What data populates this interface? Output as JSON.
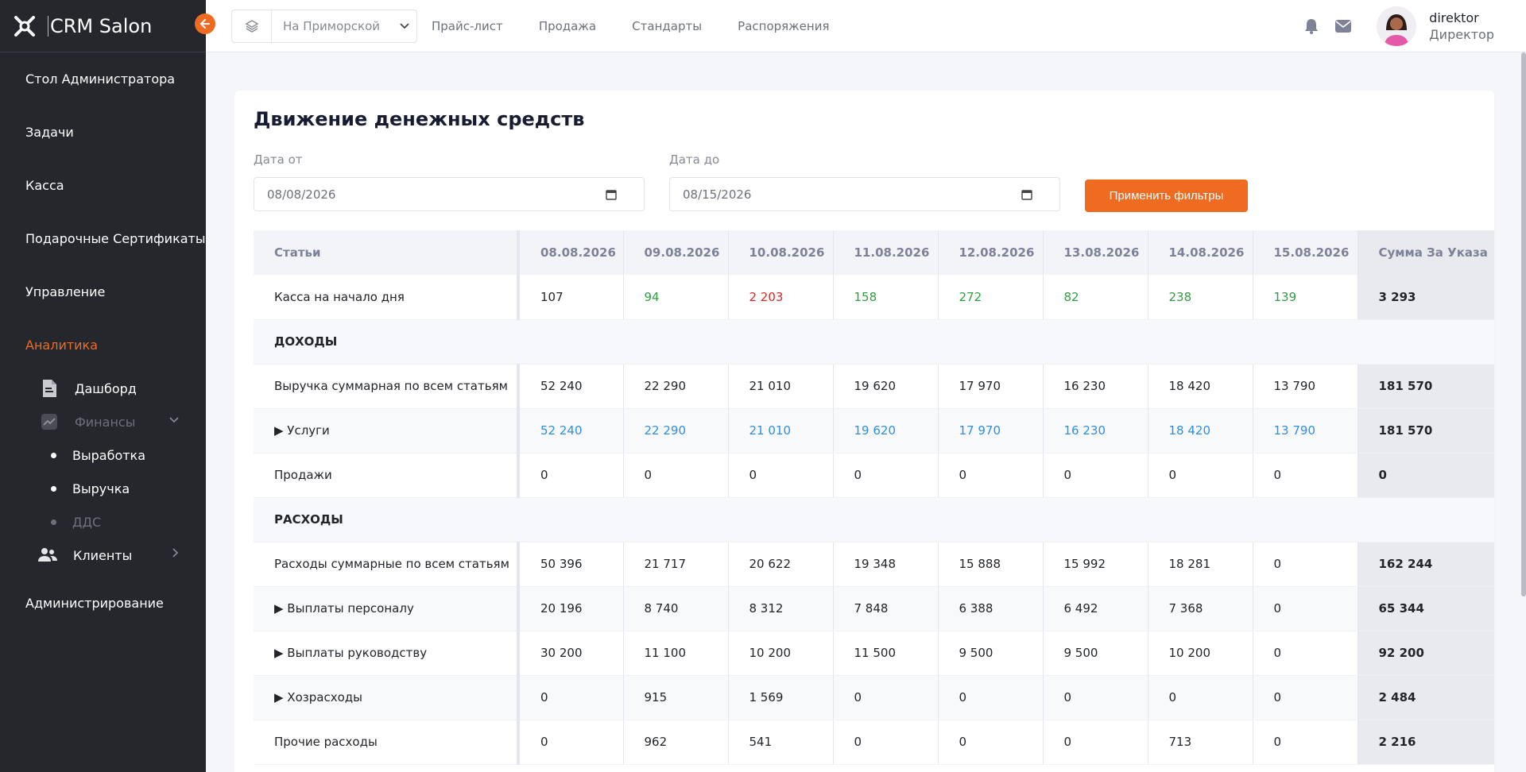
{
  "sidebar": {
    "brand": "CRM Salon",
    "items": [
      {
        "label": "Стол Администратора"
      },
      {
        "label": "Задачи"
      },
      {
        "label": "Касса"
      },
      {
        "label": "Подарочные Сертификаты"
      },
      {
        "label": "Управление"
      },
      {
        "label": "Аналитика"
      }
    ],
    "analytics_sub": {
      "dashboard": "Дашборд",
      "finance": "Финансы",
      "finance_items": [
        "Выработка",
        "Выручка",
        "ДДС"
      ],
      "clients": "Клиенты"
    },
    "admin": "Администрирование"
  },
  "topbar": {
    "branch": "На Приморской",
    "nav": [
      "Прайс-лист",
      "Продажа",
      "Стандарты",
      "Распоряжения"
    ],
    "user_name": "direktor",
    "user_role": "Директор"
  },
  "card": {
    "title": "Движение денежных средств",
    "date_from_label": "Дата от",
    "date_from": "08/08/2026",
    "date_to_label": "Дата до",
    "date_to": "08/15/2026",
    "apply": "Применить фильтры"
  },
  "table": {
    "headers": [
      "Статьи",
      "08.08.2026",
      "09.08.2026",
      "10.08.2026",
      "11.08.2026",
      "12.08.2026",
      "13.08.2026",
      "14.08.2026",
      "15.08.2026",
      "Сумма За Указа"
    ],
    "rows": [
      {
        "label": "Касса на начало дня",
        "cells": [
          "107",
          "94",
          "2 203",
          "158",
          "272",
          "82",
          "238",
          "139"
        ],
        "colors": [
          "",
          "green",
          "red",
          "green",
          "green",
          "green",
          "green",
          "green"
        ],
        "sum": "3 293"
      },
      {
        "section": "ДОХОДЫ"
      },
      {
        "label": "Выручка суммарная по всем статьям",
        "cells": [
          "52 240",
          "22 290",
          "21 010",
          "19 620",
          "17 970",
          "16 230",
          "18 420",
          "13 790"
        ],
        "sum": "181 570"
      },
      {
        "label": "▶ Услуги",
        "cells": [
          "52 240",
          "22 290",
          "21 010",
          "19 620",
          "17 970",
          "16 230",
          "18 420",
          "13 790"
        ],
        "color": "blue",
        "sum": "181 570",
        "alt": true
      },
      {
        "label": "Продажи",
        "cells": [
          "0",
          "0",
          "0",
          "0",
          "0",
          "0",
          "0",
          "0"
        ],
        "sum": "0"
      },
      {
        "section": "РАСХОДЫ"
      },
      {
        "label": "Расходы суммарные по всем статьям",
        "cells": [
          "50 396",
          "21 717",
          "20 622",
          "19 348",
          "15 888",
          "15 992",
          "18 281",
          "0"
        ],
        "sum": "162 244"
      },
      {
        "label": "▶ Выплаты персоналу",
        "cells": [
          "20 196",
          "8 740",
          "8 312",
          "7 848",
          "6 388",
          "6 492",
          "7 368",
          "0"
        ],
        "sum": "65 344",
        "alt": true
      },
      {
        "label": "▶ Выплаты руководству",
        "cells": [
          "30 200",
          "11 100",
          "10 200",
          "11 500",
          "9 500",
          "9 500",
          "10 200",
          "0"
        ],
        "sum": "92 200"
      },
      {
        "label": "▶ Хозрасходы",
        "cells": [
          "0",
          "915",
          "1 569",
          "0",
          "0",
          "0",
          "0",
          "0"
        ],
        "sum": "2 484",
        "alt": true
      },
      {
        "label": "Прочие расходы",
        "cells": [
          "0",
          "962",
          "541",
          "0",
          "0",
          "0",
          "713",
          "0"
        ],
        "sum": "2 216"
      }
    ]
  },
  "colors": {
    "accent": "#f06b22",
    "sidebar": "#25272d",
    "green": "#2f9e44",
    "red": "#e02424",
    "blue": "#2d8fe0"
  }
}
